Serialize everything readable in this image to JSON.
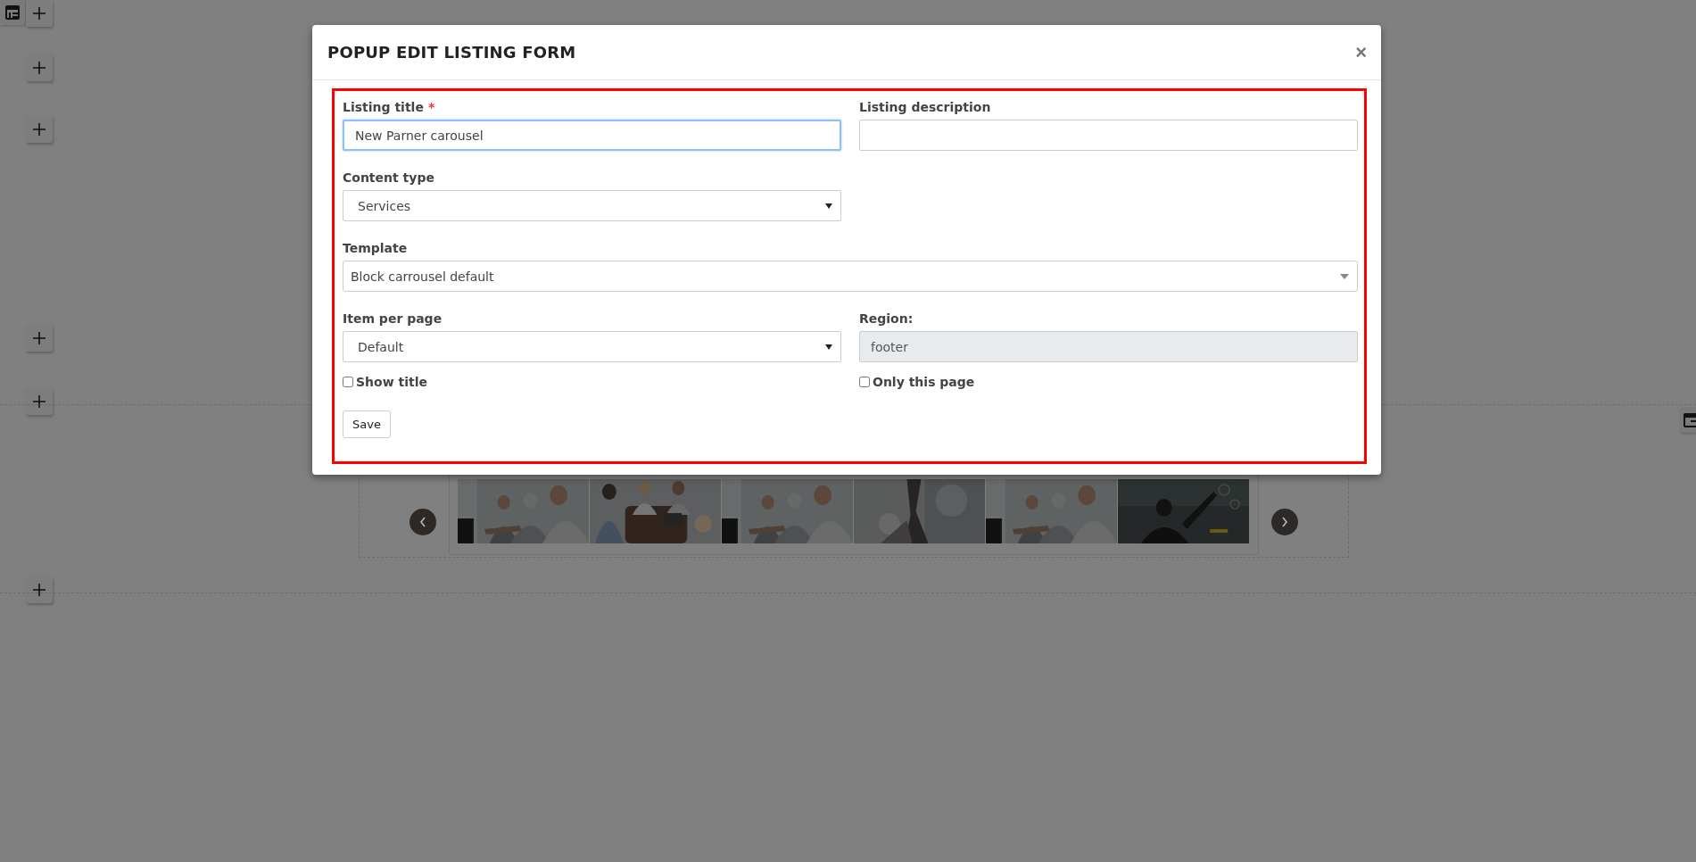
{
  "modal": {
    "title": "POPUP EDIT LISTING FORM",
    "close": "×",
    "rows": [
      [
        {
          "kind": "text",
          "label": "Listing title",
          "required_mark": "*",
          "value": "New Parner carousel",
          "focused": true
        },
        {
          "kind": "text",
          "label": "Listing description",
          "focused": false
        }
      ],
      [
        {
          "kind": "select",
          "label": "Content type",
          "value": "Services"
        }
      ],
      [
        {
          "kind": "combo",
          "label": "Template",
          "value": "Block carrousel default"
        }
      ],
      [
        {
          "kind": "select",
          "label": "Item per page",
          "value": "Default"
        },
        {
          "kind": "readonly",
          "label": "Region:",
          "value": "footer"
        }
      ],
      [
        {
          "kind": "checkbox",
          "label": "Show title",
          "checked": false
        },
        {
          "kind": "checkbox",
          "label": "Only this page",
          "checked": false
        }
      ]
    ],
    "save_button": "Save"
  }
}
